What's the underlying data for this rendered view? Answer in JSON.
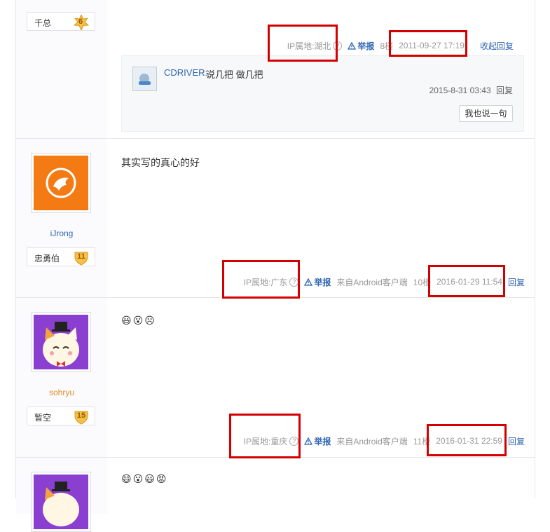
{
  "posts": [
    {
      "author": {
        "name": "",
        "rank_title": "千总",
        "level": "6"
      },
      "content": "",
      "tail": {
        "ip": "IP属地:湖北",
        "report": "举报",
        "source": "",
        "floor": "8楼",
        "time": "2011-09-27 17:19",
        "reply": "收起回复"
      },
      "lzl": {
        "user": "CDRIVER:",
        "text": "说几把 做几把",
        "time": "2015-8-31 03:43",
        "reply": "回复",
        "button": "我也说一句"
      }
    },
    {
      "author": {
        "name": "iJrong",
        "rank_title": "忠勇伯",
        "level": "11"
      },
      "content": "其实写的真心的好",
      "tail": {
        "ip": "IP属地:广东",
        "report": "举报",
        "source": "来自Android客户端",
        "floor": "10楼",
        "time": "2016-01-29 11:54",
        "reply": "回复"
      }
    },
    {
      "author": {
        "name": "sohryu",
        "rank_title": "暂空",
        "level": "15"
      },
      "content": "",
      "tail": {
        "ip": "IP属地:重庆",
        "report": "举报",
        "source": "来自Android客户端",
        "floor": "11楼",
        "time": "2016-01-31 22:59",
        "reply": "回复"
      }
    },
    {
      "author": {
        "name": "",
        "rank_title": "",
        "level": ""
      },
      "content": ""
    }
  ],
  "icons": {
    "help": "?",
    "report": "warning-triangle-icon",
    "level_badge": "heart-shield-icon",
    "emoji_smile": "😃",
    "emoji_surprised": "😮",
    "emoji_sad": "☹",
    "emoji_grin": "😄",
    "emoji_angry": "😡"
  },
  "colors": {
    "link": "#2d64b3",
    "highlight": "#d40000",
    "username_orange": "#e58a2c"
  }
}
